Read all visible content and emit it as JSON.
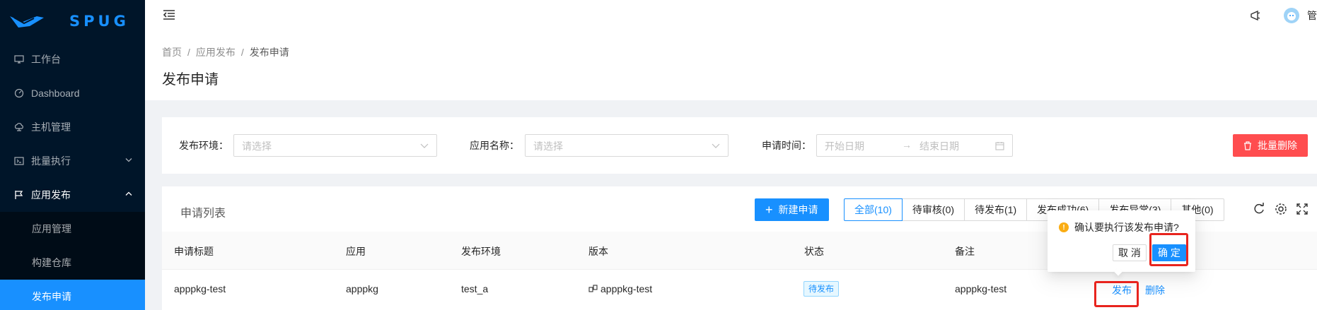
{
  "app": {
    "brand": "SPUG",
    "user_initial": "管"
  },
  "sidebar": {
    "items": [
      {
        "label": "工作台",
        "icon": "desktop-icon"
      },
      {
        "label": "Dashboard",
        "icon": "dashboard-icon"
      },
      {
        "label": "主机管理",
        "icon": "cloud-server-icon"
      },
      {
        "label": "批量执行",
        "icon": "code-icon"
      },
      {
        "label": "应用发布",
        "icon": "flag-icon"
      }
    ],
    "subitems": [
      {
        "label": "应用管理"
      },
      {
        "label": "构建仓库"
      },
      {
        "label": "发布申请"
      }
    ]
  },
  "breadcrumb": {
    "home": "首页",
    "parent": "应用发布",
    "current": "发布申请"
  },
  "page_title": "发布申请",
  "filters": {
    "env_label": "发布环境：",
    "env_placeholder": "请选择",
    "app_label": "应用名称：",
    "app_placeholder": "请选择",
    "time_label": "申请时间：",
    "start_placeholder": "开始日期",
    "end_placeholder": "结束日期",
    "batch_delete": "批量删除"
  },
  "list": {
    "title": "申请列表",
    "new_button": "新建申请",
    "tabs": [
      "全部(10)",
      "待审核(0)",
      "待发布(1)",
      "发布成功(6)",
      "发布异常(3)",
      "其他(0)"
    ],
    "columns": [
      "申请标题",
      "应用",
      "发布环境",
      "版本",
      "状态",
      "备注"
    ],
    "rows": [
      {
        "title": "apppkg-test",
        "app": "apppkg",
        "env": "test_a",
        "version": "apppkg-test",
        "status": "待发布",
        "remark": "apppkg-test",
        "action_publish": "发布",
        "action_delete": "删除"
      }
    ]
  },
  "popconfirm": {
    "message": "确认要执行该发布申请?",
    "cancel": "取 消",
    "ok": "确 定"
  },
  "colors": {
    "primary": "#1890ff",
    "danger": "#ff4d4f",
    "sider_bg": "#001529",
    "highlight": "#e8241e"
  }
}
